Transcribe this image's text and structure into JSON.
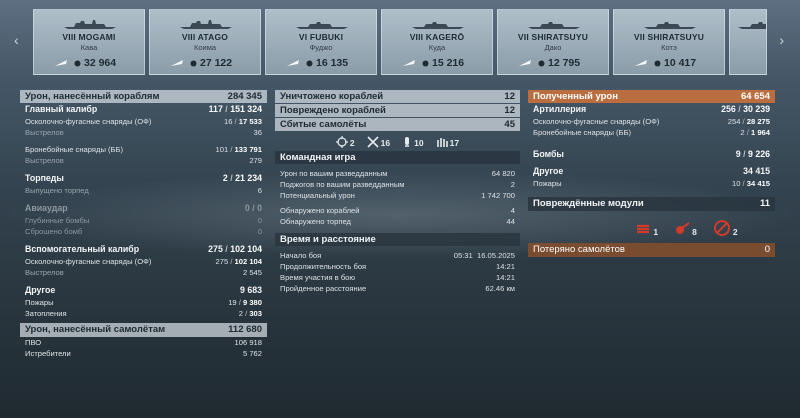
{
  "carousel": {
    "prev_arrow": "‹",
    "next_arrow": "›",
    "ships": [
      {
        "tier_name": "VIII MOGAMI",
        "sub": "Кава",
        "value": "32 964"
      },
      {
        "tier_name": "VIII ATAGO",
        "sub": "Коима",
        "value": "27 122"
      },
      {
        "tier_name": "VI FUBUKI",
        "sub": "Фуджо",
        "value": "16 135"
      },
      {
        "tier_name": "VIII KAGERŌ",
        "sub": "Куда",
        "value": "15 216"
      },
      {
        "tier_name": "VII SHIRATSUYU",
        "sub": "Дако",
        "value": "12 795"
      },
      {
        "tier_name": "VII SHIRATSUYU",
        "sub": "Котэ",
        "value": "10 417"
      }
    ]
  },
  "damage": {
    "title": "Урон, нанесённый кораблям",
    "total": "284 345",
    "main": {
      "label": "Главный калибр",
      "shots": "117",
      "hits": "151 324"
    },
    "he": {
      "label": "Осколочно-фугасные снаряды (ОФ)",
      "a": "16",
      "b": "17 533"
    },
    "he_shots": {
      "label": "Выстрелов",
      "value": "36"
    },
    "ap": {
      "label": "Бронебойные снаряды (ББ)",
      "a": "101",
      "b": "133 791"
    },
    "ap_shots": {
      "label": "Выстрелов",
      "value": "279"
    },
    "torp": {
      "label": "Торпеды",
      "a": "2",
      "b": "21 234"
    },
    "torp_fired": {
      "label": "Выпущено торпед",
      "value": "6"
    },
    "air": {
      "label": "Авиаудар",
      "a": "0",
      "b": "0"
    },
    "depth": {
      "label": "Глубинные бомбы",
      "value": "0"
    },
    "bombs_dropped": {
      "label": "Сброшено бомб",
      "value": "0"
    },
    "sec": {
      "label": "Вспомогательный калибр",
      "a": "275",
      "b": "102 104"
    },
    "sec_he": {
      "label": "Осколочно-фугасные снаряды (ОФ)",
      "a": "275",
      "b": "102 104"
    },
    "sec_shots": {
      "label": "Выстрелов",
      "value": "2 545"
    },
    "other": {
      "label": "Другое",
      "value": "9 683"
    },
    "fires": {
      "label": "Пожары",
      "a": "19",
      "b": "9 380"
    },
    "floods": {
      "label": "Затопления",
      "a": "2",
      "b": "303"
    },
    "planes_title": "Урон, нанесённый самолётам",
    "planes_total": "112 680",
    "aa": {
      "label": "ПВО",
      "value": "106 918"
    },
    "fighters": {
      "label": "Истребители",
      "value": "5 762"
    }
  },
  "kills": {
    "destroyed": {
      "label": "Уничтожено кораблей",
      "value": "12"
    },
    "damaged": {
      "label": "Повреждено кораблей",
      "value": "12"
    },
    "planes": {
      "label": "Сбитые самолёты",
      "value": "45"
    },
    "icon_counts": [
      "2",
      "16",
      "10",
      "17"
    ],
    "team_title": "Командная игра",
    "spot_dmg": {
      "label": "Урон по вашим разведданным",
      "value": "64 820"
    },
    "spot_fires": {
      "label": "Поджогов по вашим разведданным",
      "value": "2"
    },
    "potential": {
      "label": "Потенциальный урон",
      "value": "1 742 700"
    },
    "spotted_ships": {
      "label": "Обнаружено кораблей",
      "value": "4"
    },
    "spotted_torps": {
      "label": "Обнаружено торпед",
      "value": "44"
    },
    "time_title": "Время и расстояние",
    "start": {
      "label": "Начало боя",
      "time": "05:31",
      "date": "16.05.2025"
    },
    "duration": {
      "label": "Продолжительность боя",
      "value": "14:21"
    },
    "participation": {
      "label": "Время участия в бою",
      "value": "14:21"
    },
    "distance": {
      "label": "Пройденное расстояние",
      "value": "62.46 км"
    }
  },
  "received": {
    "title": "Полученный урон",
    "total": "64 654",
    "artillery": {
      "label": "Артиллерия",
      "a": "256",
      "b": "30 239"
    },
    "he": {
      "label": "Осколочно-фугасные снаряды (ОФ)",
      "a": "254",
      "b": "28 275"
    },
    "ap": {
      "label": "Бронебойные снаряды (ББ)",
      "a": "2",
      "b": "1 964"
    },
    "bombs": {
      "label": "Бомбы",
      "a": "9",
      "b": "9 226"
    },
    "other": {
      "label": "Другое",
      "value": "34 415"
    },
    "fires": {
      "label": "Пожары",
      "a": "10",
      "b": "34 415"
    },
    "modules_title": "Повреждённые модули",
    "modules_total": "11",
    "module_counts": [
      "1",
      "8",
      "2"
    ],
    "lost_title": "Потеряно самолётов",
    "lost_total": "0"
  },
  "colors": {
    "orange": "#c4703c",
    "brown": "#824e2d",
    "accent_red": "#d23a2a"
  }
}
